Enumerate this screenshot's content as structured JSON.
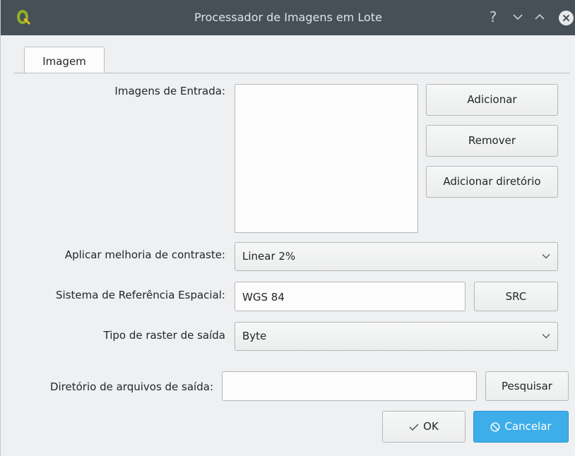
{
  "window": {
    "title": "Processador de Imagens em Lote",
    "help_glyph": "?"
  },
  "tabs": [
    {
      "label": "Imagem",
      "active": true
    }
  ],
  "input_images": {
    "label": "Imagens de Entrada:",
    "items": [],
    "buttons": {
      "add": "Adicionar",
      "remove": "Remover",
      "add_dir": "Adicionar diretório"
    }
  },
  "contrast": {
    "label": "Aplicar melhoria de contraste:",
    "selected": "Linear 2%"
  },
  "crs": {
    "label": "Sistema de Referência Espacial:",
    "value": "WGS 84",
    "button": "SRC"
  },
  "raster_type": {
    "label": "Tipo de raster de saída",
    "selected": "Byte"
  },
  "output_dir": {
    "label": "Diretório de arquivos de saída:",
    "value": "",
    "button": "Pesquisar"
  },
  "footer": {
    "ok": "OK",
    "cancel": "Cancelar"
  },
  "colors": {
    "titlebar": "#475057",
    "accent": "#3daee9",
    "window_bg": "#eff0f1"
  },
  "icons": {
    "app": "qgis-logo-icon",
    "help": "help-icon",
    "minimize": "chevron-down-icon",
    "maximize": "chevron-up-icon",
    "close": "close-icon",
    "combo": "chevron-down-icon",
    "ok": "checkmark-icon",
    "cancel": "cancel-icon"
  }
}
